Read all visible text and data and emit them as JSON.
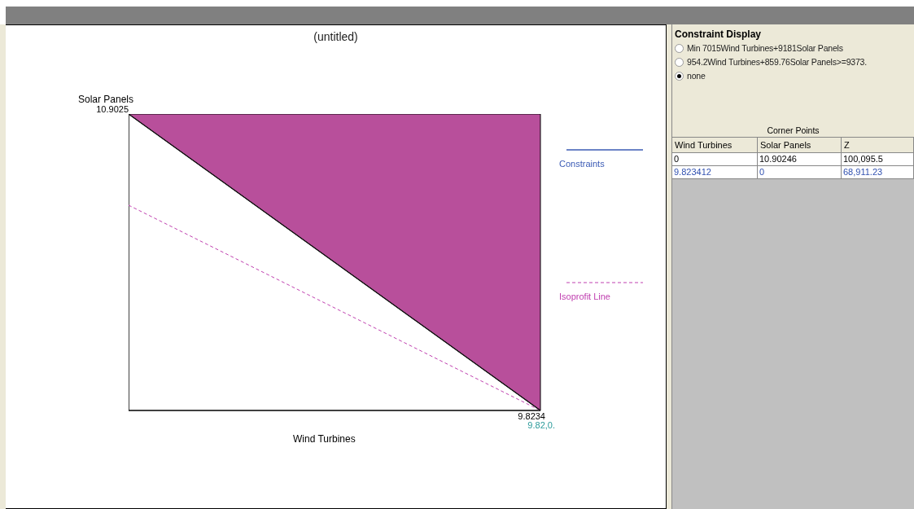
{
  "graph": {
    "title": "(untitled)",
    "y_axis_label": "Solar Panels",
    "y_max_label": "10.9025",
    "x_axis_label": "Wind Turbines",
    "x_max_label": "9.8234",
    "point_label": "9.82,0.",
    "legend": [
      {
        "kind": "solid",
        "label": "Constraints"
      },
      {
        "kind": "dashed",
        "label": "Isoprofit Line"
      }
    ]
  },
  "constraint_display": {
    "title": "Constraint Display",
    "options": [
      {
        "label": "Min 7015Wind Turbines+9181Solar Panels",
        "selected": false
      },
      {
        "label": "954.2Wind Turbines+859.76Solar Panels>=9373.",
        "selected": false
      },
      {
        "label": "none",
        "selected": true
      }
    ]
  },
  "corner_points": {
    "title": "Corner Points",
    "columns": [
      "Wind Turbines",
      "Solar Panels",
      "Z"
    ],
    "rows": [
      {
        "highlighted": false,
        "cells": [
          "0",
          "10.90246",
          "100,095.5"
        ]
      },
      {
        "highlighted": true,
        "cells": [
          "9.823412",
          "0",
          "68,911.23"
        ]
      }
    ]
  }
}
